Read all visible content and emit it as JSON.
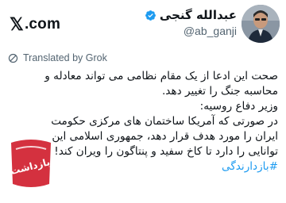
{
  "brand": {
    "x_text": "𝕏",
    "com_text": ".com"
  },
  "author": {
    "name": "عبدالله گنجی",
    "handle": "@ab_ganji",
    "verified": true
  },
  "translation": {
    "label": "Translated by Grok"
  },
  "post": {
    "lines": [
      "صحت این ادعا از یک مقام نظامی می تواند معادله و",
      "محاسبه جنگ را تغییر دهد.",
      "وزیر دفاع روسیه:",
      "در صورتی که آمریکا ساختمان های مرکزی حکومت",
      "ایران را مورد هدف قرار دهد، جمهوری اسلامی این",
      "توانایی را دارد تا کاخ سفید و پنتاگون را ویران کند!"
    ],
    "hashtag": "#بازدارندگی"
  },
  "watermark": {
    "text": "بازداشت"
  },
  "colors": {
    "accent": "#1d9bf0",
    "muted": "#536471",
    "watermark": "#d01f2f"
  }
}
